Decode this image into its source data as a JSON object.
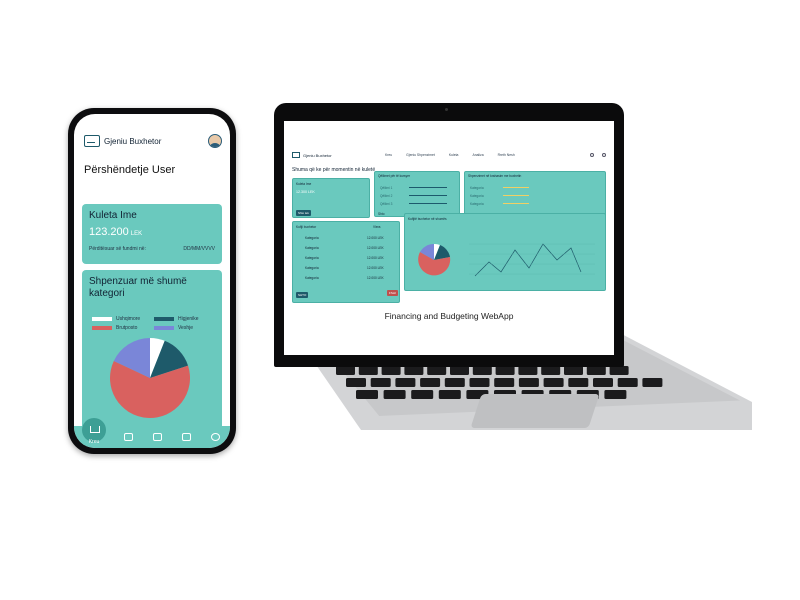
{
  "phone": {
    "app_name": "Gjeniu Buxhetor",
    "greeting": "Përshëndetje User",
    "wallet": {
      "title": "Kuleta Ime",
      "amount": "123.200",
      "currency": "LEK",
      "updated_label": "Përditësuar së fundmi në:",
      "updated_value": "DD/MM/VVVV"
    },
    "categories": {
      "title": "Shpenzuar më shumë kategori",
      "legend": [
        {
          "name": "Ushqimore",
          "color": "#ffffff"
        },
        {
          "name": "Higjenike",
          "color": "#1e5a6a"
        },
        {
          "name": "Brutposto",
          "color": "#d9615f"
        },
        {
          "name": "Veshje",
          "color": "#7a86d8"
        }
      ],
      "pie": [
        {
          "name": "Ushqimore",
          "value": 6,
          "color": "#ffffff"
        },
        {
          "name": "Higjenike",
          "value": 14,
          "color": "#1e5a6a"
        },
        {
          "name": "Brutposto",
          "value": 62,
          "color": "#d9615f"
        },
        {
          "name": "Veshje",
          "value": 18,
          "color": "#7a86d8"
        }
      ]
    },
    "nav": {
      "home_label": "Kreu"
    }
  },
  "laptop": {
    "app_name": "Gjeniu Buxhetor",
    "nav": [
      "Kreu",
      "Gjeniu Shpenzimet",
      "Kuleta",
      "Analiza",
      "Rreth Nesh"
    ],
    "heading": "Shuma që ke për momentin në kuletë",
    "wallet": {
      "title": "Kuleta Ime",
      "amount": "12.300 LEK",
      "button": "Shto lek"
    },
    "goals": {
      "title": "Qëllimet për të kursyer",
      "items": [
        "Qëllimi 1",
        "Qëllimi 2",
        "Qëllimi 3"
      ],
      "more": "Shto"
    },
    "expenses": {
      "title": "Shpenzimet në krahasim me buxhetin",
      "items": [
        "Kategoria",
        "Kategoria",
        "Kategoria"
      ]
    },
    "budget": {
      "title": "Kufiji buxhetor",
      "col": "Vlera",
      "rows": [
        "Kategoria",
        "Kategoria",
        "Kategoria",
        "Kategoria",
        "Kategoria"
      ],
      "value": "12.000 LEK",
      "button_add": "SHTO",
      "button_del": "FSHI"
    },
    "chart": {
      "title": "Kufijtë buxhetor në shumës"
    },
    "caption": "Financing and Budgeting WebApp"
  },
  "chart_data": [
    {
      "type": "pie",
      "title": "Shpenzuar më shumë kategori",
      "categories": [
        "Ushqimore",
        "Higjenike",
        "Brutposto",
        "Veshje"
      ],
      "values": [
        6,
        14,
        62,
        18
      ]
    }
  ]
}
